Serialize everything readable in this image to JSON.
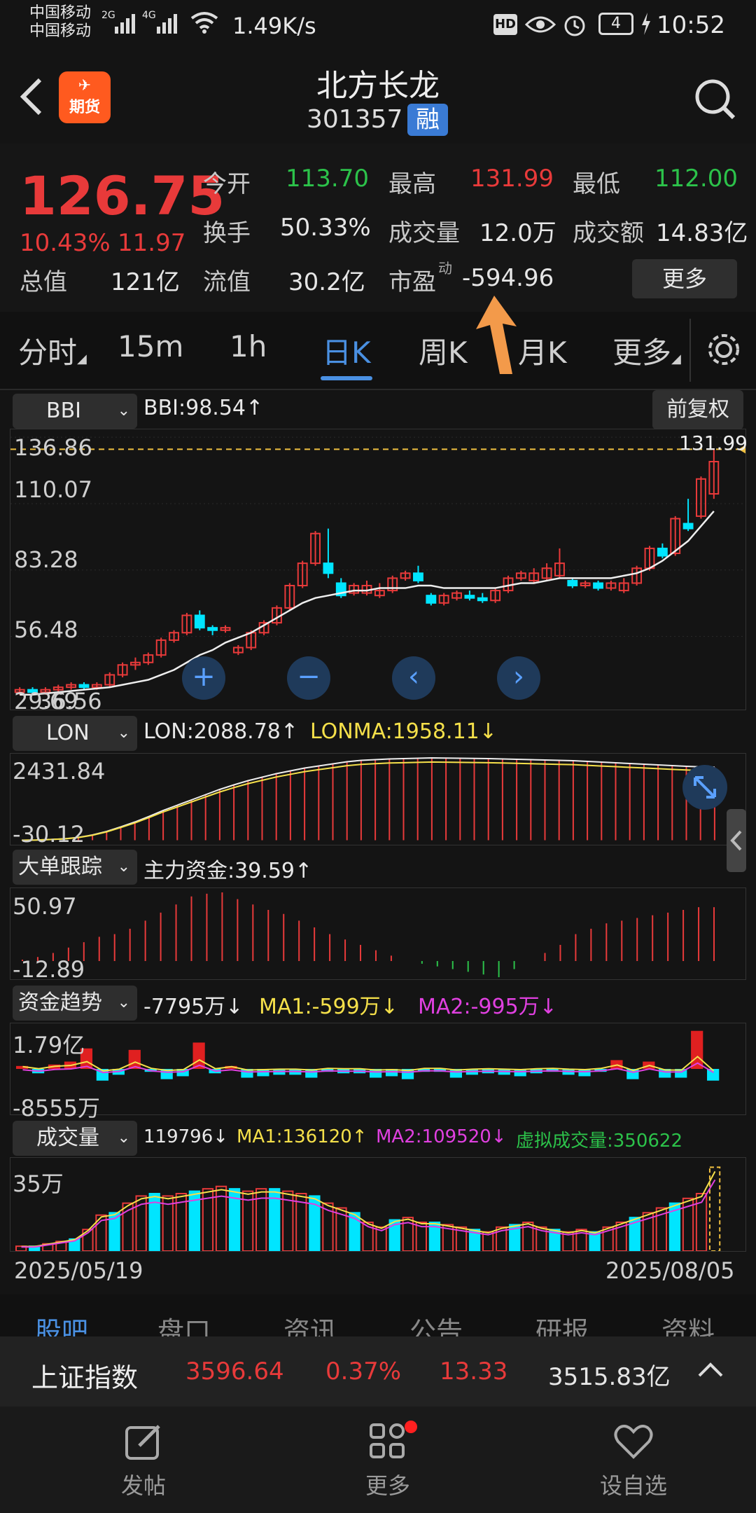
{
  "status": {
    "carrier1": "中国移动",
    "carrier2": "中国移动",
    "signal1": "2G",
    "signal2": "4G",
    "speed": "1.49K/s",
    "hd": "HD",
    "battery": "4",
    "time": "10:52"
  },
  "header": {
    "title": "北方长龙",
    "code": "301357",
    "margin_badge": "融",
    "logo_text": "期货"
  },
  "quote": {
    "price": "126.75",
    "change_pct": "10.43%",
    "change": "11.97",
    "open_label": "今开",
    "open": "113.70",
    "high_label": "最高",
    "high": "131.99",
    "low_label": "最低",
    "low": "112.00",
    "turnover_label": "换手",
    "turnover": "50.33%",
    "volume_label": "成交量",
    "volume": "12.0万",
    "amount_label": "成交额",
    "amount": "14.83亿",
    "mktcap_label": "总值",
    "mktcap": "121亿",
    "float_label": "流值",
    "float": "30.2亿",
    "pe_label": "市盈",
    "pe_sup": "动",
    "pe": "-594.96",
    "more_btn": "更多"
  },
  "tabs": [
    "分时",
    "15m",
    "1h",
    "日K",
    "周K",
    "月K",
    "更多"
  ],
  "active_tab": "日K",
  "main_chart": {
    "indicator_select": "BBI",
    "indicator_value": "BBI:98.54↑",
    "adjust_btn": "前复权",
    "y_ticks": [
      "136.86",
      "110.07",
      "83.28",
      "56.48",
      "29.69"
    ],
    "last_label": "36.56",
    "high_marker": "131.99",
    "plus": "+",
    "minus": "−",
    "left": "‹",
    "right": "›"
  },
  "lon": {
    "select": "LON",
    "value": "LON:2088.78↑",
    "ma": "LONMA:1958.11↓",
    "y_top": "2431.84",
    "y_bottom": "-30.12"
  },
  "big_order": {
    "select": "大单跟踪",
    "value": "主力资金:39.59↑",
    "y_top": "50.97",
    "y_bottom": "-12.89"
  },
  "fund_trend": {
    "select": "资金趋势",
    "value": "-7795万↓",
    "ma1": "MA1:-599万↓",
    "ma2": "MA2:-995万↓",
    "y_top": "1.79亿",
    "y_bottom": "-8555万"
  },
  "volume": {
    "select": "成交量",
    "value": "119796↓",
    "ma1": "MA1:136120↑",
    "ma2": "MA2:109520↓",
    "virtual": "虚拟成交量:350622",
    "y_top": "35万",
    "date_start": "2025/05/19",
    "date_end": "2025/08/05"
  },
  "bottom_tabs": [
    "股吧",
    "盘口",
    "资讯",
    "公告",
    "研报",
    "资料"
  ],
  "index_bar": {
    "name": "上证指数",
    "price": "3596.64",
    "pct": "0.37%",
    "change": "13.33",
    "amount": "3515.83亿"
  },
  "nav": {
    "post": "发帖",
    "more": "更多",
    "watch": "设自选"
  },
  "colors": {
    "up": "#e83a3a",
    "down": "#00e5ff",
    "accent": "#4a90e2",
    "gold": "#f0c040"
  },
  "chart_data": {
    "type": "candlestick",
    "x_start": "2025/05/19",
    "x_end": "2025/08/05",
    "candles": [
      {
        "o": 34,
        "c": 35,
        "h": 36,
        "l": 33
      },
      {
        "o": 35,
        "c": 34,
        "h": 36,
        "l": 33
      },
      {
        "o": 34,
        "c": 35,
        "h": 36,
        "l": 33
      },
      {
        "o": 35,
        "c": 36,
        "h": 37,
        "l": 34
      },
      {
        "o": 36,
        "c": 37,
        "h": 38,
        "l": 35
      },
      {
        "o": 37,
        "c": 36,
        "h": 38,
        "l": 35
      },
      {
        "o": 36,
        "c": 37,
        "h": 38,
        "l": 35
      },
      {
        "o": 37,
        "c": 41,
        "h": 42,
        "l": 36
      },
      {
        "o": 41,
        "c": 45,
        "h": 46,
        "l": 40
      },
      {
        "o": 45,
        "c": 46,
        "h": 48,
        "l": 43
      },
      {
        "o": 46,
        "c": 49,
        "h": 50,
        "l": 45
      },
      {
        "o": 49,
        "c": 55,
        "h": 56,
        "l": 48
      },
      {
        "o": 55,
        "c": 58,
        "h": 59,
        "l": 54
      },
      {
        "o": 58,
        "c": 65,
        "h": 66,
        "l": 57
      },
      {
        "o": 65,
        "c": 60,
        "h": 67,
        "l": 59
      },
      {
        "o": 60,
        "c": 59,
        "h": 61,
        "l": 57
      },
      {
        "o": 59,
        "c": 60,
        "h": 61,
        "l": 58
      },
      {
        "o": 50,
        "c": 52,
        "h": 53,
        "l": 49
      },
      {
        "o": 52,
        "c": 58,
        "h": 59,
        "l": 51
      },
      {
        "o": 58,
        "c": 62,
        "h": 63,
        "l": 57
      },
      {
        "o": 62,
        "c": 68,
        "h": 69,
        "l": 61
      },
      {
        "o": 68,
        "c": 77,
        "h": 78,
        "l": 67
      },
      {
        "o": 77,
        "c": 86,
        "h": 87,
        "l": 76
      },
      {
        "o": 86,
        "c": 98,
        "h": 99,
        "l": 85
      },
      {
        "o": 86,
        "c": 82,
        "h": 100,
        "l": 80
      },
      {
        "o": 78,
        "c": 73,
        "h": 80,
        "l": 72
      },
      {
        "o": 74,
        "c": 77,
        "h": 78,
        "l": 73
      },
      {
        "o": 74,
        "c": 77,
        "h": 79,
        "l": 73
      },
      {
        "o": 73,
        "c": 75,
        "h": 78,
        "l": 72
      },
      {
        "o": 75,
        "c": 80,
        "h": 81,
        "l": 74
      },
      {
        "o": 80,
        "c": 82,
        "h": 83,
        "l": 79
      },
      {
        "o": 82,
        "c": 79,
        "h": 85,
        "l": 78
      },
      {
        "o": 73,
        "c": 70,
        "h": 74,
        "l": 69
      },
      {
        "o": 70,
        "c": 73,
        "h": 74,
        "l": 69
      },
      {
        "o": 72,
        "c": 74,
        "h": 75,
        "l": 71
      },
      {
        "o": 73,
        "c": 72,
        "h": 75,
        "l": 71
      },
      {
        "o": 72,
        "c": 71,
        "h": 74,
        "l": 70
      },
      {
        "o": 71,
        "c": 75,
        "h": 76,
        "l": 70
      },
      {
        "o": 75,
        "c": 80,
        "h": 81,
        "l": 74
      },
      {
        "o": 80,
        "c": 82,
        "h": 83,
        "l": 79
      },
      {
        "o": 79,
        "c": 82,
        "h": 84,
        "l": 78
      },
      {
        "o": 80,
        "c": 84,
        "h": 86,
        "l": 79
      },
      {
        "o": 81,
        "c": 86,
        "h": 92,
        "l": 80
      },
      {
        "o": 79,
        "c": 77,
        "h": 80,
        "l": 76
      },
      {
        "o": 77,
        "c": 78,
        "h": 79,
        "l": 76
      },
      {
        "o": 78,
        "c": 76,
        "h": 79,
        "l": 75
      },
      {
        "o": 76,
        "c": 78,
        "h": 79,
        "l": 75
      },
      {
        "o": 75,
        "c": 78,
        "h": 80,
        "l": 74
      },
      {
        "o": 78,
        "c": 84,
        "h": 85,
        "l": 77
      },
      {
        "o": 84,
        "c": 92,
        "h": 93,
        "l": 83
      },
      {
        "o": 92,
        "c": 89,
        "h": 94,
        "l": 88
      },
      {
        "o": 90,
        "c": 104,
        "h": 105,
        "l": 89
      },
      {
        "o": 102,
        "c": 100,
        "h": 112,
        "l": 99
      },
      {
        "o": 105,
        "c": 120,
        "h": 121,
        "l": 104
      },
      {
        "o": 114,
        "c": 127,
        "h": 132,
        "l": 112
      }
    ],
    "bbi": [
      33,
      33,
      33.5,
      34,
      34.5,
      35,
      35.5,
      36,
      37,
      38,
      39,
      41,
      43,
      46,
      49,
      51,
      54,
      56,
      58,
      61,
      64,
      67,
      70,
      72,
      73,
      74,
      75,
      75,
      76,
      76,
      76,
      77,
      77,
      76,
      76,
      76,
      76,
      76,
      77,
      78,
      78,
      79,
      80,
      80,
      80,
      80,
      80,
      81,
      82,
      84,
      87,
      91,
      95,
      101,
      107
    ],
    "lon_values": [
      0,
      5,
      20,
      40,
      80,
      150,
      250,
      380,
      520,
      680,
      850,
      1000,
      1150,
      1300,
      1450,
      1580,
      1700,
      1800,
      1900,
      1980,
      2060,
      2120,
      2180,
      2240,
      2280,
      2300,
      2320,
      2330,
      2340,
      2350,
      2345,
      2340,
      2335,
      2330,
      2320,
      2310,
      2300,
      2290,
      2280,
      2270,
      2250,
      2230,
      2210,
      2190,
      2170,
      2150,
      2130,
      2110,
      2095,
      2088
    ],
    "big_order_values": [
      1,
      3,
      6,
      10,
      14,
      18,
      20,
      24,
      30,
      36,
      42,
      48,
      50,
      51,
      46,
      42,
      38,
      35,
      30,
      25,
      20,
      16,
      12,
      8,
      4,
      0,
      -2,
      -4,
      -6,
      -8,
      -10,
      -12,
      -6,
      0,
      6,
      12,
      20,
      24,
      28,
      30,
      32,
      34,
      36,
      38,
      40,
      40
    ],
    "fund_values": [
      0.2,
      -0.3,
      0.3,
      0.5,
      1.4,
      -0.8,
      -0.4,
      1.3,
      -0.2,
      -0.7,
      -0.5,
      1.8,
      -0.3,
      0.2,
      -0.6,
      -0.5,
      -0.4,
      -0.4,
      -0.6,
      -0.2,
      -0.3,
      -0.3,
      -0.6,
      -0.5,
      -0.7,
      -0.2,
      -0.2,
      -0.6,
      -0.4,
      -0.3,
      -0.4,
      -0.5,
      -0.3,
      -0.2,
      -0.4,
      -0.5,
      -0.2,
      0.6,
      -0.7,
      0.5,
      -0.6,
      -0.6,
      2.6,
      -0.8
    ],
    "volume_values": [
      2,
      2,
      3,
      4,
      5,
      9,
      15,
      16,
      20,
      23,
      24,
      23,
      24,
      25,
      26,
      27,
      26,
      25,
      26,
      26,
      25,
      24,
      23,
      20,
      18,
      16,
      12,
      10,
      13,
      14,
      12,
      12,
      11,
      10,
      9,
      8,
      10,
      11,
      12,
      10,
      9,
      8,
      9,
      8,
      10,
      12,
      14,
      16,
      18,
      20,
      22,
      24,
      35
    ]
  }
}
